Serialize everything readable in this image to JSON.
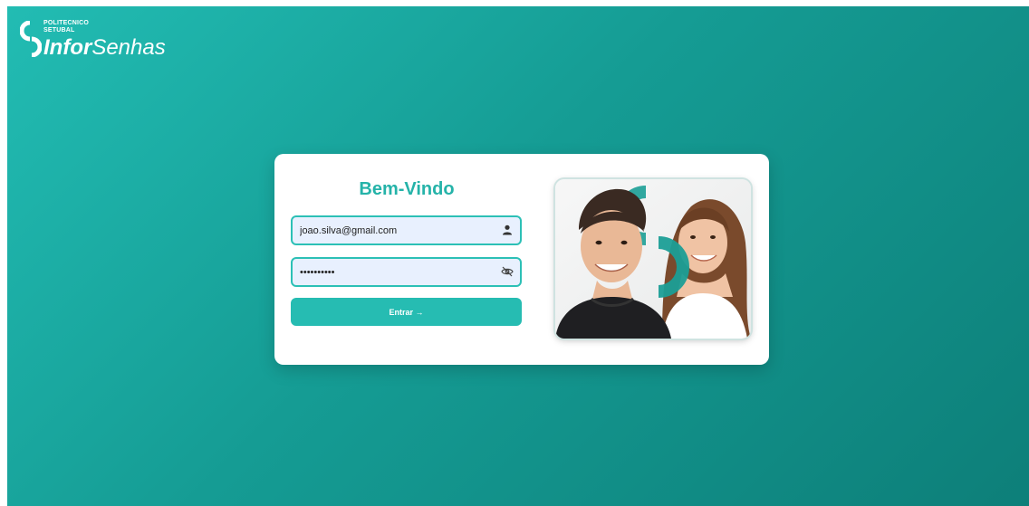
{
  "brand": {
    "line1": "POLITECNICO",
    "line2": "SETUBAL",
    "word_bold": "Infor",
    "word_regular": "Senhas"
  },
  "login": {
    "title": "Bem-Vindo",
    "email_value": "joao.silva@gmail.com",
    "password_value": "••••••••••",
    "submit_label": "Entrar →"
  },
  "icons": {
    "user": "user-icon",
    "password_visibility": "eye-off-icon"
  },
  "colors": {
    "bg_start": "#22bcb3",
    "bg_end": "#0d7f79",
    "accent": "#26bcb2",
    "field_bg": "#e8f0fe"
  }
}
